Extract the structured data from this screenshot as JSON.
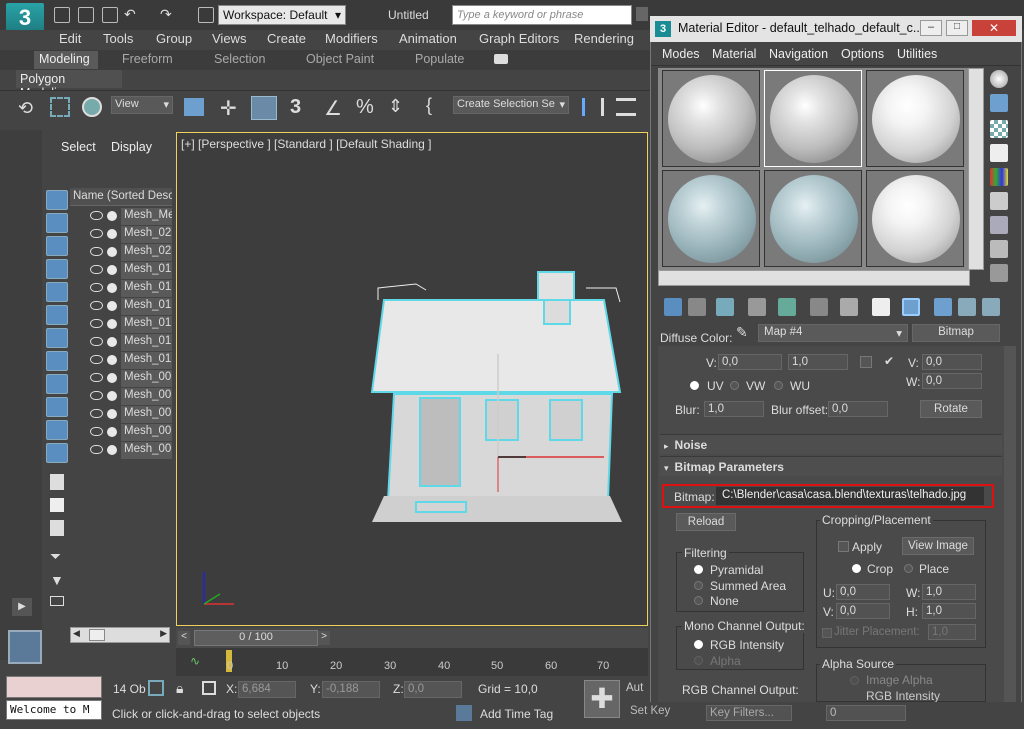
{
  "app": {
    "logo": "3",
    "workspace": "Workspace: Default",
    "file_title": "Untitled",
    "search_placeholder": "Type a keyword or phrase"
  },
  "menus": [
    "Edit",
    "Tools",
    "Group",
    "Views",
    "Create",
    "Modifiers",
    "Animation",
    "Graph Editors",
    "Rendering"
  ],
  "ribbon": {
    "tabs": [
      "Modeling",
      "Freeform",
      "Selection",
      "Object Paint",
      "Populate"
    ],
    "sub_tab": "Polygon Modeling"
  },
  "toolbar": {
    "view_select": "View",
    "selection_set": "Create Selection Se"
  },
  "scene_explorer": {
    "tabs": [
      "Select",
      "Display"
    ],
    "header": "Name (Sorted Desce",
    "items": [
      "Mesh_Me",
      "Mesh_02",
      "Mesh_02",
      "Mesh_01",
      "Mesh_01",
      "Mesh_01",
      "Mesh_01",
      "Mesh_01",
      "Mesh_01",
      "Mesh_00",
      "Mesh_00",
      "Mesh_00",
      "Mesh_00",
      "Mesh_00"
    ]
  },
  "viewport": {
    "label": "[+] [Perspective ] [Standard ] [Default Shading ]"
  },
  "timeline": {
    "position": "0 / 100",
    "ticks": [
      "0",
      "10",
      "20",
      "30",
      "40",
      "50",
      "60",
      "70"
    ]
  },
  "status": {
    "objects": "14 Ob",
    "x_label": "X:",
    "x_val": "6,684",
    "y_label": "Y:",
    "y_val": "-0,188",
    "z_label": "Z:",
    "z_val": "0,0",
    "grid": "Grid = 10,0",
    "prompt": "Click or click-and-drag to select objects",
    "add_time_tag": "Add Time Tag",
    "listener": "Welcome to M",
    "auto": "Aut",
    "set_key": "Set Key",
    "key_filters": "Key Filters...",
    "frame": "0"
  },
  "material_editor": {
    "title": "Material Editor - default_telhado_default_c...",
    "menu": [
      "Modes",
      "Material",
      "Navigation",
      "Options",
      "Utilities"
    ],
    "slots": [
      "grey",
      "grey",
      "white",
      "blue",
      "blue",
      "white"
    ],
    "diffuse_label": "Diffuse Color:",
    "map_name": "Map #4",
    "map_type": "Bitmap",
    "coords": {
      "v_label": "V:",
      "v_val": "0,0",
      "v2": "1,0",
      "v_right_label": "V:",
      "v_right": "0,0",
      "w_label": "W:",
      "w_val": "0,0",
      "uv": "UV",
      "vw": "VW",
      "wu": "WU",
      "blur_label": "Blur:",
      "blur_val": "1,0",
      "blur_offset_label": "Blur offset:",
      "blur_offset_val": "0,0",
      "rotate": "Rotate"
    },
    "noise_header": "Noise",
    "bitmap_header": "Bitmap Parameters",
    "bitmap_label": "Bitmap:",
    "bitmap_path": "C:\\Blender\\casa\\casa.blend\\texturas\\telhado.jpg",
    "reload": "Reload",
    "filtering": {
      "title": "Filtering",
      "options": [
        "Pyramidal",
        "Summed Area",
        "None"
      ]
    },
    "mono": {
      "title": "Mono Channel Output:",
      "options": [
        "RGB Intensity",
        "Alpha"
      ]
    },
    "rgb_title": "RGB Channel Output:",
    "crop": {
      "title": "Cropping/Placement",
      "apply": "Apply",
      "view_image": "View Image",
      "crop": "Crop",
      "place": "Place",
      "u_label": "U:",
      "u_val": "0,0",
      "w_label": "W:",
      "w_val": "1,0",
      "v_label": "V:",
      "v_val": "0,0",
      "h_label": "H:",
      "h_val": "1,0",
      "jitter": "Jitter Placement:",
      "jitter_val": "1,0"
    },
    "alpha": {
      "title": "Alpha Source",
      "options": [
        "Image Alpha",
        "RGB Intensity"
      ]
    }
  }
}
